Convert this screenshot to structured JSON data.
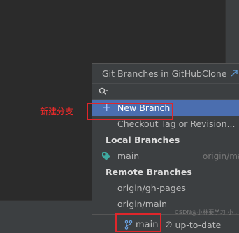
{
  "popup": {
    "title": "Git Branches in GitHubClone",
    "search": {
      "value": "",
      "placeholder": ""
    },
    "new_branch_label": "New Branch",
    "checkout_tag_label": "Checkout Tag or Revision...",
    "local_section": "Local Branches",
    "local_branches": [
      {
        "name": "main",
        "hint": "origin/ma"
      }
    ],
    "remote_section": "Remote Branches",
    "remote_branches": [
      {
        "name": "origin/gh-pages"
      },
      {
        "name": "origin/main"
      }
    ]
  },
  "annotation": {
    "label": "新建分支",
    "color": "#e0262b"
  },
  "statusbar": {
    "branch": "main",
    "branch_icon": "git-branch-icon",
    "sync_symbol": "∅",
    "sync_text": "up-to-date"
  },
  "watermark": "CSDN@小林要学习 小 ...",
  "colors": {
    "selection": "#4b6eaf",
    "tag_icon": "#3fa9a0",
    "annotation": "#e0262b"
  }
}
